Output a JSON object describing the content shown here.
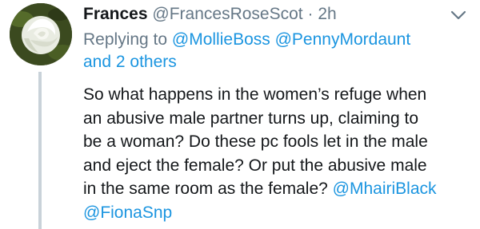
{
  "author": {
    "display_name": "Frances",
    "handle": "@FrancesRoseScot",
    "separator": "·",
    "timestamp": "2h"
  },
  "replying": {
    "prefix": "Replying to",
    "mentions": [
      "@MollieBoss",
      "@PennyMordaunt"
    ],
    "others": "and 2 others"
  },
  "tweet_text": {
    "line1": "So what happens in the women’s refuge when",
    "line2": "an abusive male partner turns up, claiming to",
    "line3": "be a woman? Do these pc fools let in the male",
    "line4": "and eject the female? Or put the abusive male",
    "line5": "in the same room as the female?",
    "mention_1": "@MhairiBlack",
    "mention_2": "@FionaSnp"
  },
  "icons": {
    "avatar": "white-rose-avatar",
    "menu": "chevron-down-icon"
  },
  "colors": {
    "link": "#1b95e0",
    "meta": "#657786",
    "text": "#14171a",
    "thread_line": "#c9d2d9"
  }
}
